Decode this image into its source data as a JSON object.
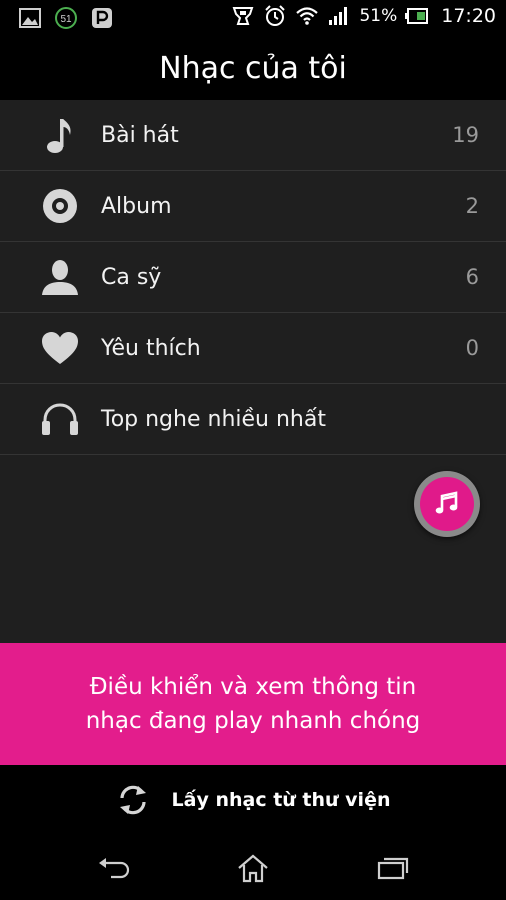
{
  "status_bar": {
    "battery_percent": "51%",
    "time": "17:20",
    "notification_badge": "51",
    "left_icons": [
      "gallery-icon",
      "badge-51-icon",
      "p-app-icon"
    ],
    "right_icons": [
      "game-controller-icon",
      "alarm-clock-icon",
      "wifi-icon",
      "signal-icon",
      "battery-icon"
    ]
  },
  "header": {
    "title": "Nhạc của tôi"
  },
  "menu": {
    "items": [
      {
        "label": "Bài hát",
        "count": "19",
        "icon": "music-note-icon"
      },
      {
        "label": "Album",
        "count": "2",
        "icon": "disc-icon"
      },
      {
        "label": "Ca sỹ",
        "count": "6",
        "icon": "person-icon"
      },
      {
        "label": "Yêu thích",
        "count": "0",
        "icon": "heart-icon"
      },
      {
        "label": "Top nghe nhiều nhất",
        "count": "",
        "icon": "headphones-icon"
      }
    ]
  },
  "fab": {
    "icon": "music-notes-icon"
  },
  "banner": {
    "line1": "Điều khiển và xem thông tin",
    "line2": "nhạc đang play nhanh chóng"
  },
  "library": {
    "label": "Lấy nhạc từ thư viện",
    "icon": "sync-icon"
  },
  "nav": {
    "icons": [
      "back-icon",
      "home-icon",
      "recent-apps-icon"
    ]
  },
  "colors": {
    "accent": "#e31d8c",
    "list_background": "#1f1f1f",
    "divider": "#343434",
    "count_text": "#9a9a9a",
    "bar_background": "#000000"
  }
}
